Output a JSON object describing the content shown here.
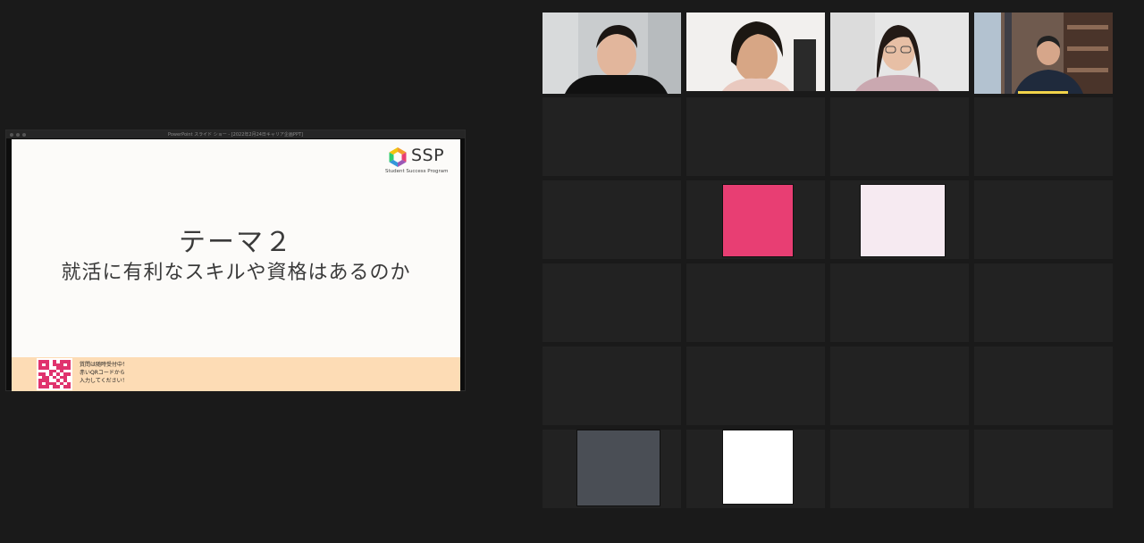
{
  "share": {
    "window_title": "PowerPoint スライド ショー - [2022年2月24日キャリア企画PPT]",
    "logo": {
      "name": "SSP",
      "subtitle": "Student Success Program"
    },
    "slide_title": "テーマ２",
    "slide_subtitle": "就活に有利なスキルや資格はあるのか",
    "footer_lines": [
      "質問は随時受付中！",
      "赤いQRコードから",
      "入力してください！"
    ]
  },
  "participants": [
    {
      "name": "participant-1",
      "kind": "video",
      "active": true
    },
    {
      "name": "participant-2",
      "kind": "video",
      "active": false
    },
    {
      "name": "participant-3",
      "kind": "video",
      "active": false
    },
    {
      "name": "participant-4",
      "kind": "video",
      "active": false,
      "speaking": true
    }
  ],
  "avatars": [
    {
      "name": "avatar-pink",
      "color": "#e83e73"
    },
    {
      "name": "avatar-light-pink",
      "color": "#f6eaf1"
    },
    {
      "name": "avatar-slate",
      "color": "#4a4e55"
    },
    {
      "name": "avatar-white",
      "color": "#ffffff"
    }
  ],
  "colors": {
    "background": "#1a1a1a",
    "tile": "#222222",
    "active_border": "#c6e36a",
    "speaking_bar": "#f2d44a",
    "footer": "#fddcb5"
  }
}
